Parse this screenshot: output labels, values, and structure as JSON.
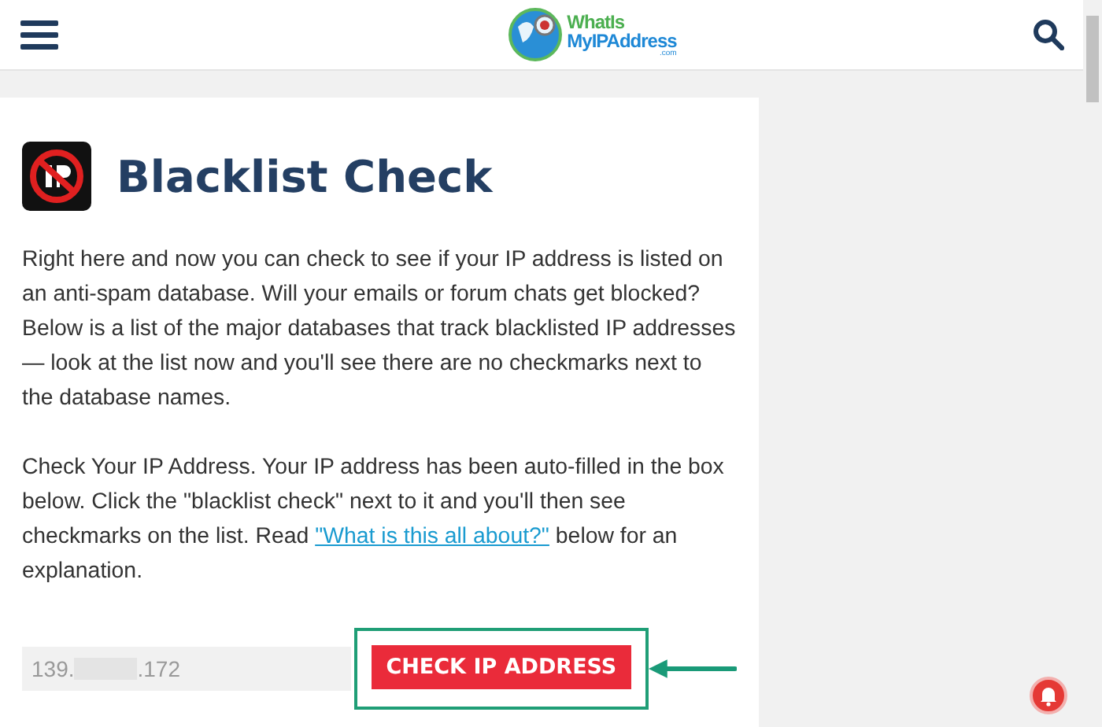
{
  "header": {
    "logo": {
      "line_1": "WhatIs",
      "line_2": "MyIPAddress",
      "line_3": ".com"
    }
  },
  "page": {
    "title": "Blacklist Check",
    "intro": "Right here and now you can check to see if your IP address is listed on an anti-spam database. Will your emails or forum chats get blocked? Below is a list of the major databases that track blacklisted IP addresses — look at the list now and you'll see there are no checkmarks next to the database names.",
    "instructions": {
      "before": "Check Your IP Address. Your IP address has been auto-filled in the box below. Click the \"blacklist check\" next to it and you'll then see checkmarks on the list. Read ",
      "link": "\"What is this all about?\"",
      "after": " below for an explanation."
    },
    "ip_field": {
      "value_start": "139.",
      "value_end": ".172"
    },
    "button": "CHECK IP ADDRESS"
  }
}
